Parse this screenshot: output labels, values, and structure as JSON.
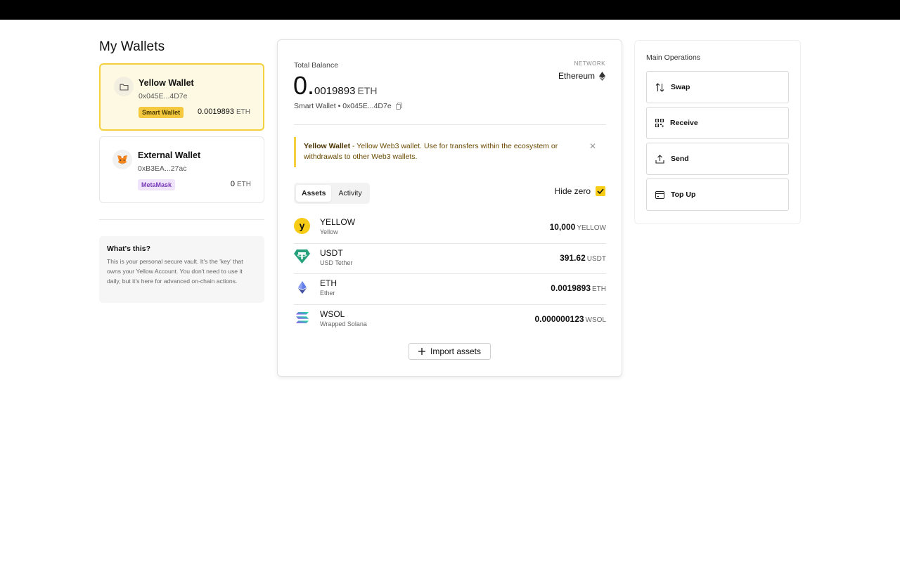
{
  "page": {
    "title": "My Wallets"
  },
  "wallets": [
    {
      "name": "Yellow Wallet",
      "address": "0x045E...4D7e",
      "badge": "Smart Wallet",
      "balance": "0.0019893",
      "unit": "ETH",
      "active": true
    },
    {
      "name": "External Wallet",
      "address": "0xB3EA...27ac",
      "badge": "MetaMask",
      "balance": "0",
      "unit": "ETH",
      "active": false
    }
  ],
  "info": {
    "title": "What's this?",
    "text": "This is your personal secure vault. It's the 'key' that owns your Yellow Account. You don't need to use it daily, but it's here for advanced on-chain actions."
  },
  "balance": {
    "label": "Total Balance",
    "integer": "0.",
    "fraction": "0019893",
    "unit": "ETH",
    "subtitle": "Smart Wallet • 0x045E...4D7e",
    "network_label": "NETWORK",
    "network": "Ethereum"
  },
  "notice": {
    "title": "Yellow Wallet",
    "text": " - Yellow Web3 wallet. Use for transfers within the ecosystem or withdrawals to other Web3 wallets."
  },
  "tabs": [
    {
      "label": "Assets",
      "active": true
    },
    {
      "label": "Activity",
      "active": false
    }
  ],
  "hide_zero": {
    "label": "Hide zero",
    "checked": true
  },
  "assets": [
    {
      "symbol": "YELLOW",
      "name": "Yellow",
      "balance": "10,000",
      "unit": "YELLOW",
      "icon": "yellow-token-icon"
    },
    {
      "symbol": "USDT",
      "name": "USD Tether",
      "balance": "391.62",
      "unit": "USDT",
      "icon": "usdt-token-icon"
    },
    {
      "symbol": "ETH",
      "name": "Ether",
      "balance": "0.0019893",
      "unit": "ETH",
      "icon": "eth-token-icon"
    },
    {
      "symbol": "WSOL",
      "name": "Wrapped Solana",
      "balance": "0.000000123",
      "unit": "WSOL",
      "icon": "wsol-token-icon"
    }
  ],
  "import_label": "Import assets",
  "operations": {
    "title": "Main Operations",
    "items": [
      {
        "label": "Swap",
        "icon": "swap-icon"
      },
      {
        "label": "Receive",
        "icon": "qr-code-icon"
      },
      {
        "label": "Send",
        "icon": "upload-icon"
      },
      {
        "label": "Top Up",
        "icon": "card-icon"
      }
    ]
  },
  "colors": {
    "accent": "#f6cc17",
    "accent_border": "#f4d03f",
    "active_bg": "#fef9e2"
  }
}
